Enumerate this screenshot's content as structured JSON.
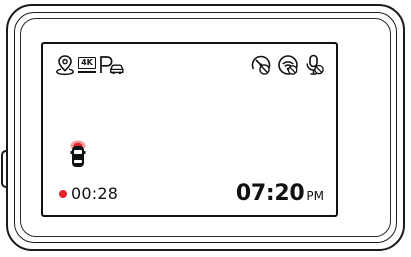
{
  "status_icons": {
    "left": [
      "gps-location-icon",
      "4k-resolution-icon",
      "parking-mode-icon"
    ],
    "right": [
      "speed-camera-off-icon",
      "wifi-off-icon",
      "microphone-off-icon"
    ]
  },
  "badge_4k": "4K",
  "recording": {
    "elapsed": "00:28",
    "dot_color": "#e0252b"
  },
  "clock": {
    "time": "07:20",
    "ampm": "PM"
  },
  "car_indicator": "car-collision-alert-icon"
}
